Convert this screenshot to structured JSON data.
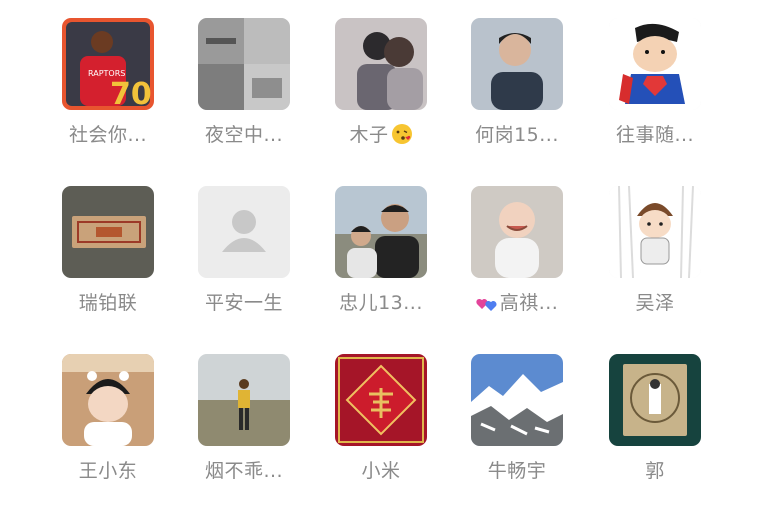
{
  "members": [
    {
      "name": "社会你...",
      "avatar_icon": "basketball-player-avatar"
    },
    {
      "name": "夜空中...",
      "avatar_icon": "street-photo-collage-avatar"
    },
    {
      "name": "木子",
      "avatar_icon": "couple-photo-avatar",
      "suffix_icon": "kiss-emoji-icon"
    },
    {
      "name": "何岗15...",
      "avatar_icon": "boy-portrait-avatar"
    },
    {
      "name": "往事随...",
      "avatar_icon": "cartoon-superman-avatar"
    },
    {
      "name": "瑞铂联",
      "avatar_icon": "banknote-avatar"
    },
    {
      "name": "平安一生",
      "avatar_icon": "default-user-avatar"
    },
    {
      "name": "忠儿13...",
      "avatar_icon": "couple-outdoor-avatar"
    },
    {
      "name": "高祺...",
      "avatar_icon": "baby-photo-avatar",
      "prefix_icon": "hearts-emoji-icon"
    },
    {
      "name": "吴泽",
      "avatar_icon": "cartoon-boy-avatar"
    },
    {
      "name": "王小东",
      "avatar_icon": "child-portrait-avatar"
    },
    {
      "name": "烟不乖...",
      "avatar_icon": "field-figure-avatar"
    },
    {
      "name": "小米",
      "avatar_icon": "red-fu-decoration-avatar"
    },
    {
      "name": "牛畅宇",
      "avatar_icon": "snow-mountain-avatar"
    },
    {
      "name": "郭",
      "avatar_icon": "green-stamp-avatar"
    }
  ]
}
